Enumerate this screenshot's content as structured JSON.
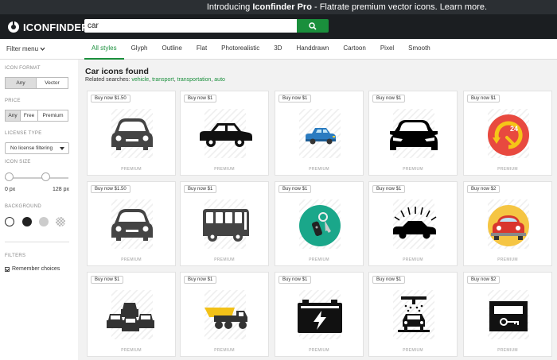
{
  "promo": {
    "prefix": "Introducing ",
    "brand": "Iconfinder Pro",
    "suffix": " - Flatrate premium vector icons. Learn more."
  },
  "logo": {
    "text": "ICONFINDER"
  },
  "search": {
    "value": "car"
  },
  "filter_menu": "Filter menu",
  "tabs": [
    "All styles",
    "Glyph",
    "Outline",
    "Flat",
    "Photorealistic",
    "3D",
    "Handdrawn",
    "Cartoon",
    "Pixel",
    "Smooth"
  ],
  "sidebar": {
    "icon_format": {
      "label": "ICON FORMAT",
      "options": [
        "Any",
        "Vector"
      ],
      "selected": "Any"
    },
    "price": {
      "label": "PRICE",
      "options": [
        "Any",
        "Free",
        "Premium"
      ],
      "selected": "Any"
    },
    "license_type": {
      "label": "LICENSE TYPE",
      "value": "No license filtering"
    },
    "icon_size": {
      "label": "ICON SIZE",
      "min": "0 px",
      "max": "128 px"
    },
    "background": {
      "label": "BACKGROUND",
      "colors": [
        "#ffffff",
        "#222222",
        "#cccccc",
        "checkered"
      ]
    },
    "filters": {
      "label": "FILTERS",
      "remember": "Remember choices",
      "checked": true
    }
  },
  "results": {
    "title": "Car icons found",
    "related_prefix": "Related searches: ",
    "related": [
      "vehicle",
      "transport",
      "transportation",
      "auto"
    ],
    "premium_label": "PREMIUM",
    "icons": [
      {
        "price": "Buy now $1.50",
        "icon": "car-front-icon"
      },
      {
        "price": "Buy now $1",
        "icon": "car-side-icon"
      },
      {
        "price": "Buy now $1",
        "icon": "blue-car-icon"
      },
      {
        "price": "Buy now $1",
        "icon": "car-front-black-icon"
      },
      {
        "price": "Buy now $1",
        "icon": "car-service-24-icon"
      },
      {
        "price": "Buy now $1.50",
        "icon": "car-front-icon"
      },
      {
        "price": "Buy now $1",
        "icon": "bus-icon"
      },
      {
        "price": "Buy now $1",
        "icon": "car-keys-icon"
      },
      {
        "price": "Buy now $1",
        "icon": "car-wash-sparkle-icon"
      },
      {
        "price": "Buy now $2",
        "icon": "beetle-car-icon"
      },
      {
        "price": "Buy now $1",
        "icon": "traffic-jam-icon"
      },
      {
        "price": "Buy now $1",
        "icon": "dump-truck-icon"
      },
      {
        "price": "Buy now $1",
        "icon": "car-battery-icon"
      },
      {
        "price": "Buy now $1",
        "icon": "car-wash-icon"
      },
      {
        "price": "Buy now $2",
        "icon": "car-door-key-icon"
      }
    ]
  }
}
